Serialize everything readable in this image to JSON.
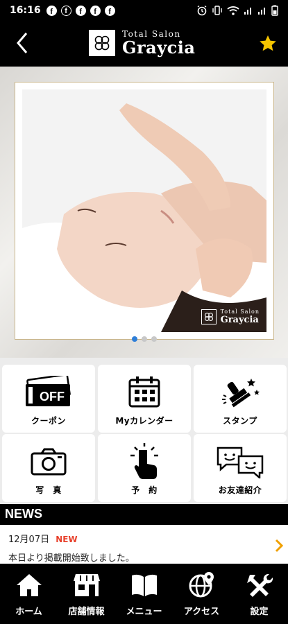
{
  "status": {
    "time": "16:16",
    "notifications": [
      "facebook-icon",
      "facebook-icon",
      "facebook-icon",
      "facebook-icon",
      "facebook-icon"
    ]
  },
  "header": {
    "logo_sub": "Total Salon",
    "logo_main": "Graycia",
    "back_icon": "chevron-left-icon",
    "favorite_icon": "star-icon",
    "accent_color": "#f5c400"
  },
  "hero": {
    "watermark_sub": "Total Salon",
    "watermark_main": "Graycia",
    "slide_count": 3,
    "active_slide": 1,
    "active_dot_color": "#2f7fd8"
  },
  "menu": [
    {
      "label": "クーポン",
      "icon": "coupon-icon",
      "badge": "OFF"
    },
    {
      "label": "Myカレンダー",
      "icon": "calendar-icon"
    },
    {
      "label": "スタンプ",
      "icon": "stamp-icon"
    },
    {
      "label": "写　真",
      "icon": "camera-icon"
    },
    {
      "label": "予　約",
      "icon": "tap-hand-icon"
    },
    {
      "label": "お友達紹介",
      "icon": "chat-bubbles-icon"
    }
  ],
  "news": {
    "title": "NEWS",
    "items": [
      {
        "date": "12月07日",
        "badge": "NEW",
        "text": "本日より掲載開始致しました。"
      }
    ],
    "badge_color": "#e8412c",
    "arrow_color": "#f0a000"
  },
  "tabbar": [
    {
      "label": "ホーム",
      "icon": "home-icon"
    },
    {
      "label": "店舗情報",
      "icon": "store-icon"
    },
    {
      "label": "メニュー",
      "icon": "book-icon"
    },
    {
      "label": "アクセス",
      "icon": "globe-pin-icon"
    },
    {
      "label": "設定",
      "icon": "tools-icon"
    }
  ]
}
